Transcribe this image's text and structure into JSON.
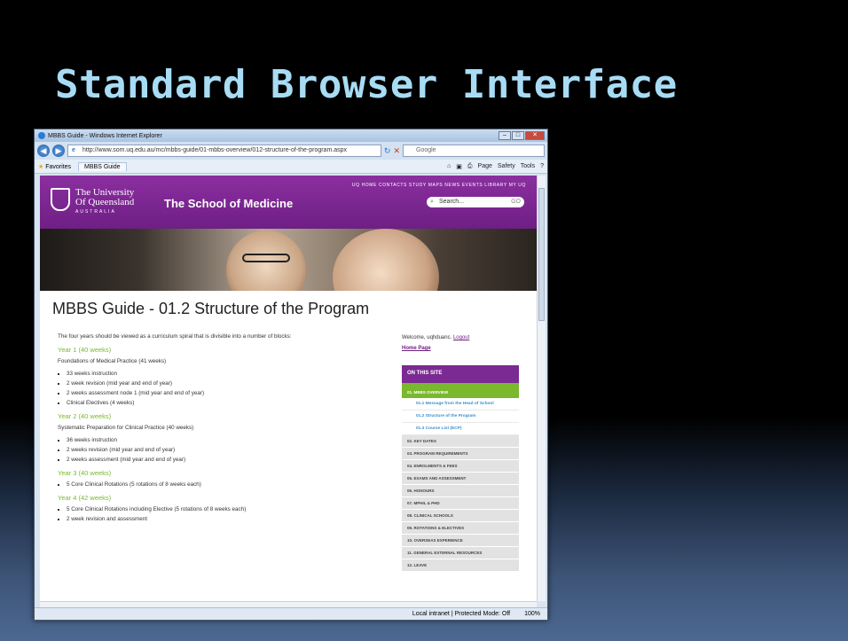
{
  "slide": {
    "title": "Standard Browser Interface"
  },
  "browser": {
    "window_title": "MBBS Guide - Windows Internet Explorer",
    "address": "http://www.som.uq.edu.au/mc/mbbs-guide/01-mbbs-overview/012-structure-of-the-program.aspx",
    "search_placeholder": "Google",
    "favorites_label": "Favorites",
    "tab_label": "MBBS Guide",
    "cmd_page": "Page",
    "cmd_safety": "Safety",
    "cmd_tools": "Tools",
    "status_zone": "Local intranet | Protected Mode: Off",
    "zoom": "100%"
  },
  "site": {
    "uni_line1": "The University",
    "uni_line2": "Of Queensland",
    "uni_sub": "AUSTRALIA",
    "school": "The School of Medicine",
    "topnav": "UQ HOME  CONTACTS  STUDY  MAPS  NEWS  EVENTS  LIBRARY  MY UQ",
    "search_placeholder": "Search...",
    "search_go": "GO"
  },
  "page": {
    "title": "MBBS Guide - 01.2 Structure of the Program",
    "intro": "The four years should be viewed as a curriculum spiral that is divisible into a number of blocks:",
    "years": [
      {
        "heading": "Year 1 (40 weeks)",
        "desc": "Foundations of Medical Practice (41 weeks)",
        "items": [
          "33 weeks instruction",
          "2 week revision (mid year and end of year)",
          "2 weeks assessment node 1 (mid year and end of year)",
          "Clinical Electives (4 weeks)"
        ]
      },
      {
        "heading": "Year 2 (40 weeks)",
        "desc": "Systematic Preparation for Clinical Practice (40 weeks)",
        "items": [
          "36 weeks instruction",
          "2 weeks revision (mid year and end of year)",
          "2 weeks assessment (mid year and end of year)"
        ]
      },
      {
        "heading": "Year 3 (40 weeks)",
        "desc": "",
        "items": [
          "5 Core Clinical Rotations (5 rotations of 8 weeks each)"
        ]
      },
      {
        "heading": "Year 4 (42 weeks)",
        "desc": "",
        "items": [
          "5 Core Clinical Rotations including Elective (5 rotations of 8 weeks each)",
          "2 week revision and assessment"
        ]
      }
    ]
  },
  "sidebar": {
    "welcome": "Welcome, uqhduanc.",
    "logout": "Logout",
    "home": "Home Page",
    "heading": "ON THIS SITE",
    "active": "01. MBBS OVERVIEW",
    "subitems": [
      "01.1 Message from the Head of School",
      "01.2 Structure of the Program",
      "01.3 Course List (ECP)"
    ],
    "items": [
      "02. KEY DATES",
      "03. PROGRAM REQUIREMENTS",
      "04. ENROLMENTS & FEES",
      "05. EXAMS AND ASSESSMENT",
      "06. HONOURS",
      "07. MPHIL & PHD",
      "08. CLINICAL SCHOOLS",
      "09. ROTATIONS & ELECTIVES",
      "10. OVERSEAS EXPERIENCE",
      "11. GENERAL EXTERNAL RESOURCES",
      "12. LEAVE"
    ]
  }
}
